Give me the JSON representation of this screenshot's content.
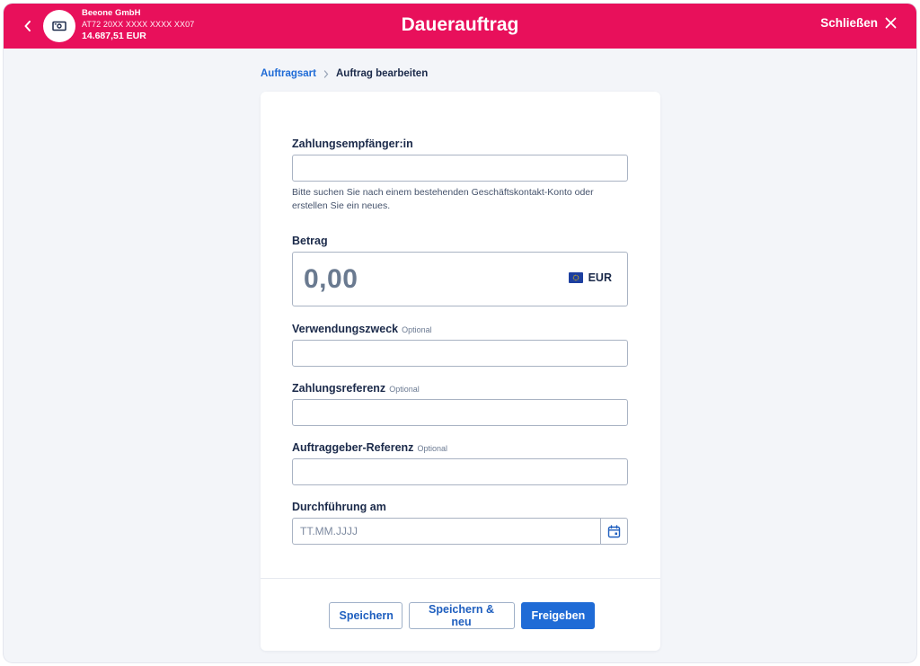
{
  "header": {
    "title": "Dauerauftrag",
    "account": {
      "name": "Beeone GmbH",
      "iban": "AT72 20XX XXXX XXXX XX07",
      "balance": "14.687,51 EUR"
    },
    "close_label": "Schließen",
    "accent_color": "#e8105b"
  },
  "breadcrumb": {
    "link": "Auftragsart",
    "current": "Auftrag bearbeiten"
  },
  "form": {
    "recipient": {
      "label": "Zahlungsempfänger:in",
      "value": "",
      "hint": "Bitte suchen Sie nach einem bestehenden Geschäftskontakt-Konto oder erstellen Sie ein neues."
    },
    "amount": {
      "label": "Betrag",
      "value": "0,00",
      "currency": "EUR",
      "currency_icon": "eu-flag-icon"
    },
    "purpose": {
      "label": "Verwendungszweck",
      "optional": "Optional",
      "value": ""
    },
    "payment_reference": {
      "label": "Zahlungsreferenz",
      "optional": "Optional",
      "value": ""
    },
    "originator_reference": {
      "label": "Auftraggeber-Referenz",
      "optional": "Optional",
      "value": ""
    },
    "execution_date": {
      "label": "Durchführung am",
      "placeholder": "TT.MM.JJJJ",
      "value": ""
    }
  },
  "actions": {
    "save": "Speichern",
    "save_new": "Speichern & neu",
    "release": "Freigeben",
    "primary_color": "#1f6bd6"
  }
}
